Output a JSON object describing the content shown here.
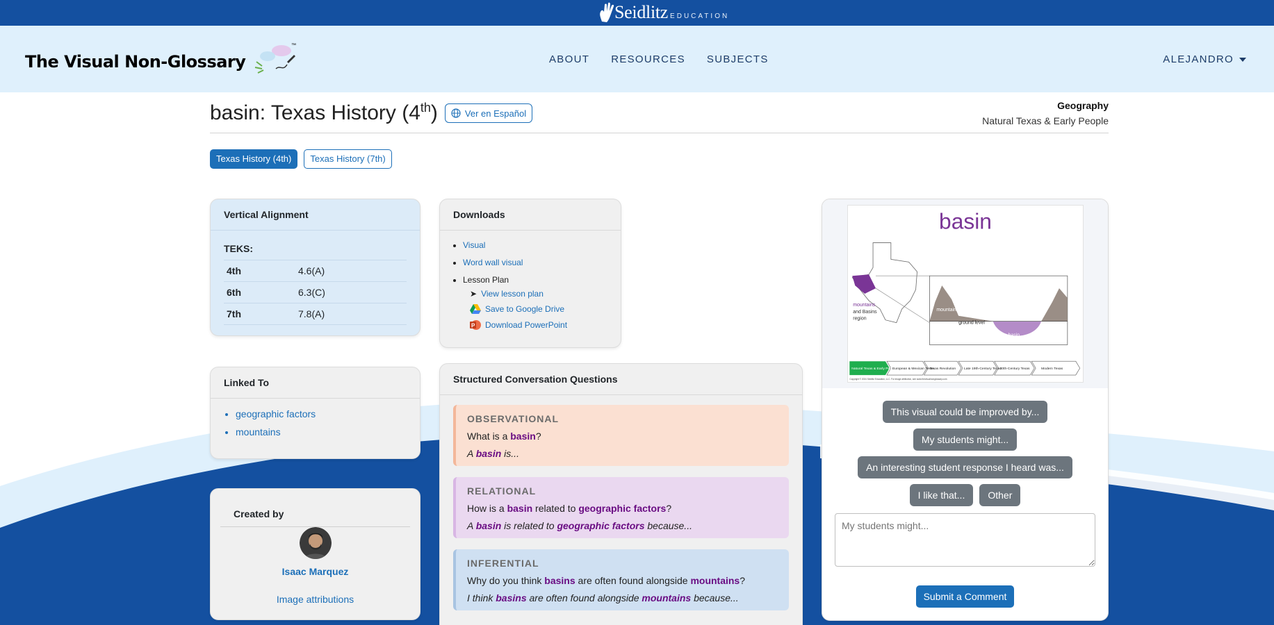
{
  "brand": {
    "name": "Seidlitz",
    "sub": "EDUCATION"
  },
  "logo": {
    "text": "The Visual Non-Glossary",
    "tm": "™"
  },
  "nav": {
    "links": [
      "ABOUT",
      "RESOURCES",
      "SUBJECTS"
    ],
    "user": "ALEJANDRO"
  },
  "page": {
    "title": "basin: Texas History (4",
    "title_sup": "th",
    "title_end": ")",
    "spanish_button": "Ver en Español"
  },
  "subject": {
    "name": "Geography",
    "unit": "Natural Texas & Early People"
  },
  "courses": [
    "Texas History (4th)",
    "Texas History (7th)"
  ],
  "vertical_alignment": {
    "heading": "Vertical Alignment",
    "teks_label": "TEKS:",
    "rows": [
      {
        "grade": "4th",
        "code": "4.6(A)"
      },
      {
        "grade": "6th",
        "code": "6.3(C)"
      },
      {
        "grade": "7th",
        "code": "7.8(A)"
      }
    ]
  },
  "downloads": {
    "heading": "Downloads",
    "items": [
      "Visual",
      "Word wall visual"
    ],
    "lesson_plan_label": "Lesson Plan",
    "view_lesson_plan": "View lesson plan",
    "save_drive": "Save to Google Drive",
    "download_ppt": "Download PowerPoint"
  },
  "linked_to": {
    "heading": "Linked To",
    "items": [
      "geographic factors",
      "mountains"
    ]
  },
  "created_by": {
    "heading": "Created by",
    "name": "Isaac Marquez",
    "attributions": "Image attributions"
  },
  "questions": {
    "heading": "Structured Conversation Questions",
    "observational": {
      "type": "OBSERVATIONAL",
      "q_pre": "What is a ",
      "q_kw": "basin",
      "q_post": "?",
      "s_pre": "A ",
      "s_kw": "basin",
      "s_post": " is..."
    },
    "relational": {
      "type": "RELATIONAL",
      "q_pre": "How is a ",
      "q_kw1": "basin",
      "q_mid": " related to ",
      "q_kw2": "geographic factors",
      "q_post": "?",
      "s_pre": "A ",
      "s_kw1": "basin",
      "s_mid": " is related to ",
      "s_kw2": "geographic factors",
      "s_post": " because..."
    },
    "inferential": {
      "type": "INFERENTIAL",
      "q_pre": "Why do you think ",
      "q_kw1": "basins",
      "q_mid": " are often found alongside ",
      "q_kw2": "mountains",
      "q_post": "?",
      "s_pre": "I think ",
      "s_kw1": "basins",
      "s_mid": " are often found alongside ",
      "s_kw2": "mountains",
      "s_post": " because..."
    }
  },
  "visual": {
    "word": "basin",
    "labels": {
      "mountains_and_basins": "mountains",
      "and_basins": "and Basins",
      "region": "region",
      "mountain": "mountain",
      "ground_level": "ground level",
      "basin": "basin"
    },
    "timeline": [
      "Natural Texas & Early People",
      "European & Mexican Texas",
      "Texas Revolution",
      "Late 19th-Century Texas",
      "20th-Century Texas",
      "Modern Texas"
    ],
    "copyright": "Copyright © 2024 Seidlitz Education, LLC. For image attribution, see www.thevisualnonglossary.com"
  },
  "feedback": {
    "buttons": [
      "This visual could be improved by...",
      "My students might...",
      "An interesting student response I heard was...",
      "I like that...",
      "Other"
    ],
    "placeholder": "My students might...",
    "submit": "Submit a Comment"
  },
  "colors": {
    "brand_blue": "#1450a0",
    "nav_bg": "#dff0fc",
    "primary": "#1c6fb8",
    "keyword": "#6a0d83"
  }
}
